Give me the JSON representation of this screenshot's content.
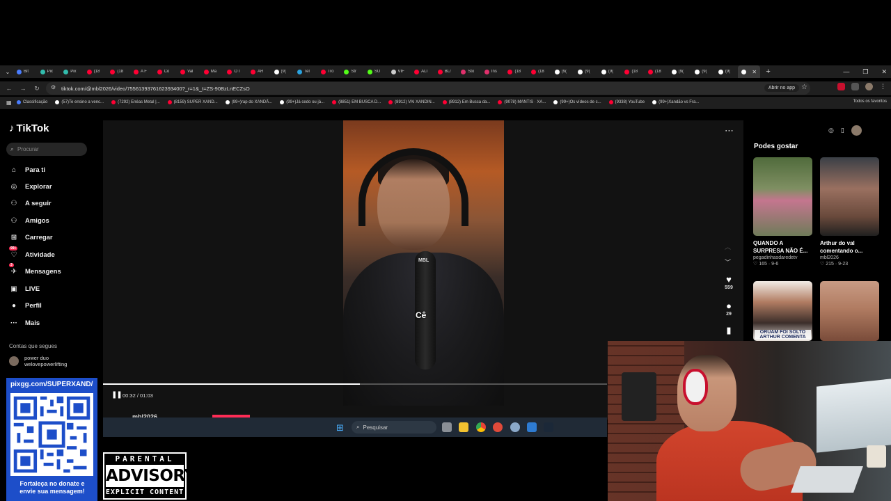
{
  "browser": {
    "tabs": [
      {
        "label": "Bit",
        "color": "#4a7dff"
      },
      {
        "label": "Pix",
        "color": "#32bcad"
      },
      {
        "label": "Pix",
        "color": "#32bcad"
      },
      {
        "label": "(18",
        "color": "#ff0033"
      },
      {
        "label": "(18",
        "color": "#ff0033"
      },
      {
        "label": "A F",
        "color": "#ff0033"
      },
      {
        "label": "Co",
        "color": "#ff0033"
      },
      {
        "label": "Val",
        "color": "#ff0033"
      },
      {
        "label": "Ma",
        "color": "#ff0033"
      },
      {
        "label": "O I",
        "color": "#ff0033"
      },
      {
        "label": "AR",
        "color": "#ff0033"
      },
      {
        "label": "(9(",
        "color": "#ffffff"
      },
      {
        "label": "Tel",
        "color": "#2aa3e0"
      },
      {
        "label": "Tro",
        "color": "#ff0033"
      },
      {
        "label": "Str",
        "color": "#53fc18"
      },
      {
        "label": "SU",
        "color": "#53fc18"
      },
      {
        "label": "VIF",
        "color": "#cccccc"
      },
      {
        "label": "ALI",
        "color": "#ff0033"
      },
      {
        "label": "BL/",
        "color": "#ff0033"
      },
      {
        "label": "Sto",
        "color": "#e1306c"
      },
      {
        "label": "Ins",
        "color": "#e1306c"
      },
      {
        "label": "(18",
        "color": "#ff0033"
      },
      {
        "label": "(18",
        "color": "#ff0033"
      },
      {
        "label": "(9(",
        "color": "#ffffff"
      },
      {
        "label": "(9(",
        "color": "#ffffff"
      },
      {
        "label": "(9(",
        "color": "#ffffff"
      },
      {
        "label": "(18",
        "color": "#ff0033"
      },
      {
        "label": "(18",
        "color": "#ff0033"
      },
      {
        "label": "(9(",
        "color": "#ffffff"
      },
      {
        "label": "(9(",
        "color": "#ffffff"
      },
      {
        "label": "(9(",
        "color": "#ffffff"
      },
      {
        "label": "",
        "color": "#ffffff",
        "active": true
      }
    ],
    "url": "tiktok.com/@mbl2026/video/7556139376162393400?_r=1&_t=ZS-90BzLnECZsO",
    "open_in_app": "Abrir no app",
    "bookmarks": [
      {
        "label": "Classificação",
        "color": "#4a7dff"
      },
      {
        "label": "(57)Te ensino a venc...",
        "color": "#ffffff"
      },
      {
        "label": "(7292) Enéas Metal |...",
        "color": "#ff0033"
      },
      {
        "label": "(8159) SUPER XAND...",
        "color": "#ff0033"
      },
      {
        "label": "(99+)rap do XANDÃ...",
        "color": "#ffffff"
      },
      {
        "label": "(99+)Já cedo ou já...",
        "color": "#ffffff"
      },
      {
        "label": "(8851) EM BUSCA D...",
        "color": "#ff0033"
      },
      {
        "label": "(8912) VAI XANDIN...",
        "color": "#ff0033"
      },
      {
        "label": "(8912) Em Busca da...",
        "color": "#ff0033"
      },
      {
        "label": "(9078) MANTIS · XA...",
        "color": "#ff0033"
      },
      {
        "label": "(99+)Os vídeos de c...",
        "color": "#ffffff"
      },
      {
        "label": "(9338) YouTube",
        "color": "#ff0033"
      },
      {
        "label": "(99+)Xandão vs Fra...",
        "color": "#ffffff"
      }
    ],
    "all_favorites": "Todos os favoritos"
  },
  "tiktok": {
    "logo": "TikTok",
    "search_placeholder": "Procurar",
    "nav": [
      {
        "label": "Para ti",
        "icon": "home-icon",
        "glyph": "⌂"
      },
      {
        "label": "Explorar",
        "icon": "compass-icon",
        "glyph": "◎"
      },
      {
        "label": "A seguir",
        "icon": "following-icon",
        "glyph": "⚇"
      },
      {
        "label": "Amigos",
        "icon": "friends-icon",
        "glyph": "⚇"
      },
      {
        "label": "Carregar",
        "icon": "upload-icon",
        "glyph": "⊞"
      },
      {
        "label": "Atividade",
        "icon": "activity-icon",
        "glyph": "♡",
        "badge": "99+"
      },
      {
        "label": "Mensagens",
        "icon": "messages-icon",
        "glyph": "✈",
        "badge": "3"
      },
      {
        "label": "LIVE",
        "icon": "live-icon",
        "glyph": "▣"
      },
      {
        "label": "Perfil",
        "icon": "profile-icon",
        "glyph": "●"
      },
      {
        "label": "Mais",
        "icon": "more-icon",
        "glyph": "···"
      }
    ],
    "follows_heading": "Contas que segues",
    "follows": [
      {
        "name": "power duo",
        "handle": "welovepowerlifting"
      }
    ],
    "video": {
      "caption": "Cê",
      "likes": "559",
      "comments": "29",
      "current_time": "00:32",
      "duration": "01:03",
      "time_display": "00:32 / 01:03",
      "progress": 0.51,
      "author_partial": "mbl2026",
      "mic_logo": "MBL"
    },
    "suggested_title": "Podes gostar",
    "suggested": [
      {
        "title": "QUANDO A SURPRESA NÃO É...",
        "author": "pegadinhasdaredetv",
        "likes": "165",
        "date": "9-6",
        "overlay": ""
      },
      {
        "title": "Arthur do val comentando o...",
        "author": "mbl2026",
        "likes": "215",
        "date": "9-23",
        "overlay": ""
      },
      {
        "title": "",
        "author": "",
        "likes": "",
        "date": "",
        "overlay": "ORUAM FOI SOLTO ARTHUR COMENTA"
      },
      {
        "title": "",
        "author": "",
        "likes": "",
        "date": "",
        "overlay": ""
      }
    ]
  },
  "taskbar": {
    "search_placeholder": "Pesquisar"
  },
  "overlay": {
    "donate_url": "pixgg.com/SUPERXAND/",
    "donate_text": "Fortaleça no donate e envie sua mensagem!",
    "parental_top": "PARENTAL",
    "parental_mid": "ADVISORY",
    "parental_bot": "EXPLICIT CONTENT"
  },
  "colors": {
    "accent": "#fe2c55",
    "donate_panel": "#1d4ec9"
  }
}
